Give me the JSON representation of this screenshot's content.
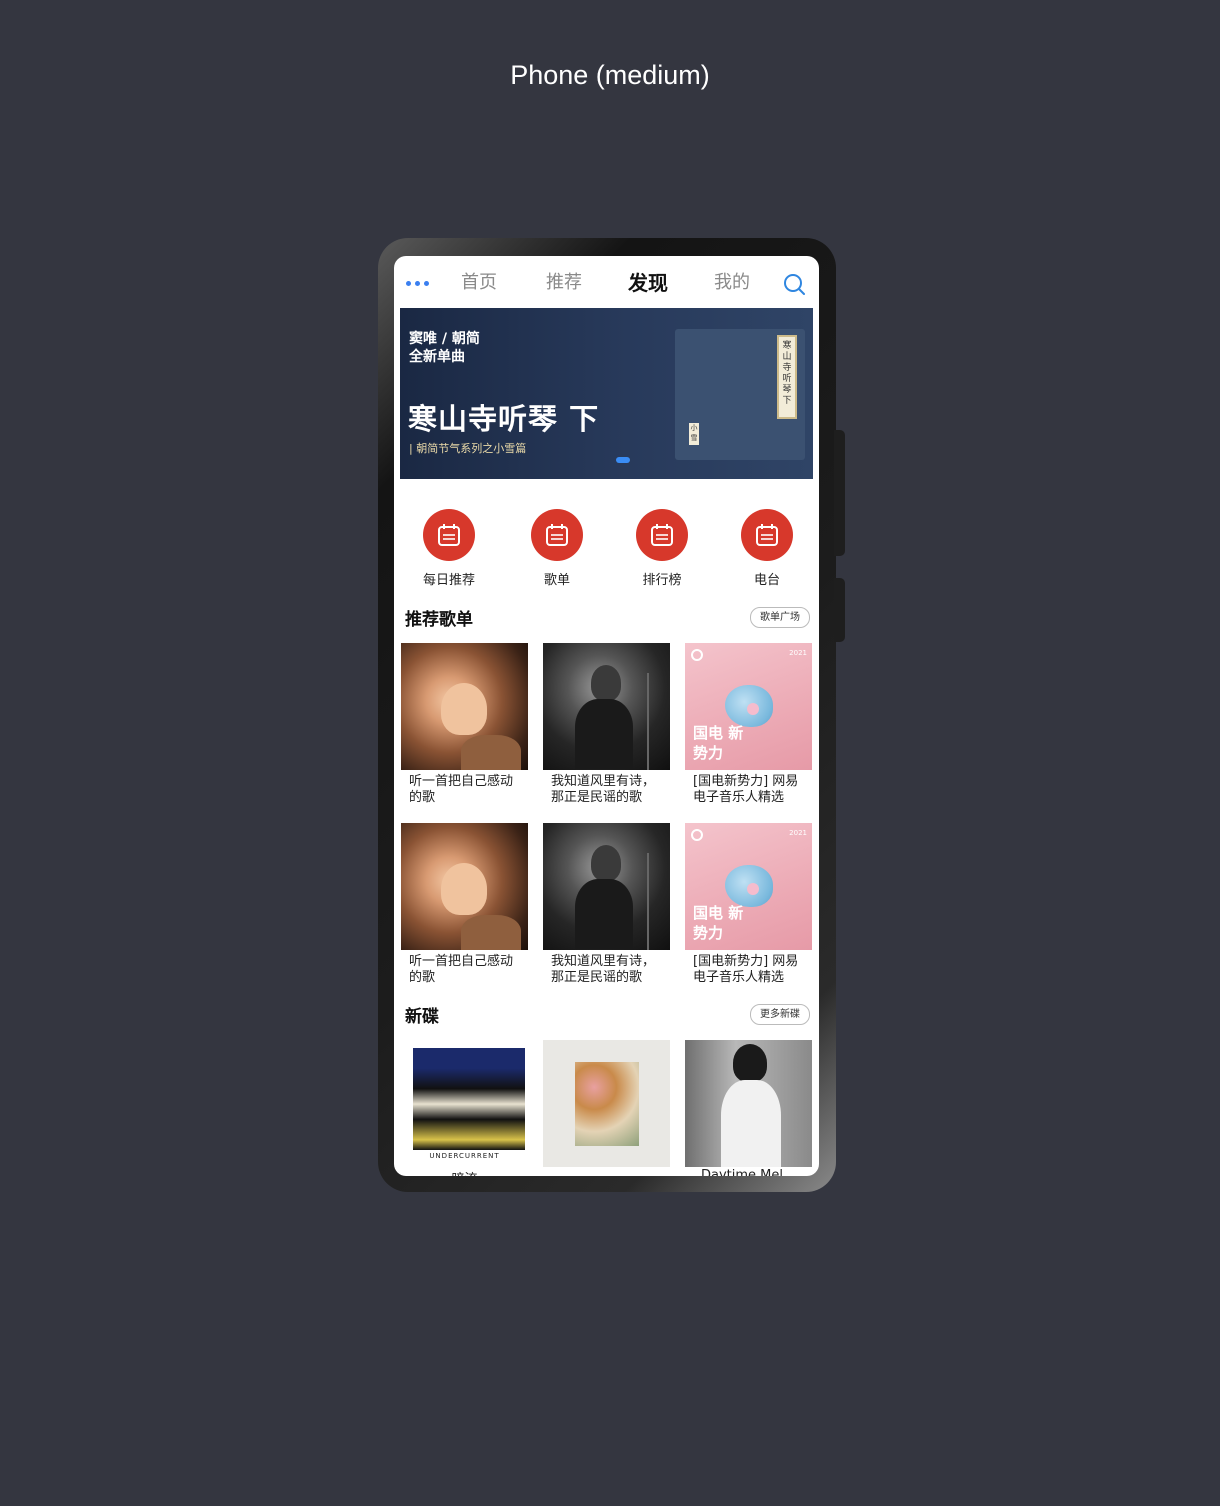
{
  "frame_title": "Phone (medium)",
  "nav": {
    "tabs": [
      "首页",
      "推荐",
      "发现",
      "我的"
    ],
    "active_tab": "发现"
  },
  "banner": {
    "artist_line1": "窦唯 / 朝简",
    "artist_line2": "全新单曲",
    "title": "寒山寺听琴 下",
    "subtitle": "| 朝简节气系列之小雪篇",
    "cover_tag": "寒山寺听琴下",
    "cover_small": "小雪"
  },
  "quick_links": [
    "每日推荐",
    "歌单",
    "排行榜",
    "电台"
  ],
  "recommended": {
    "title": "推荐歌单",
    "more_button": "歌单广场",
    "playlists": [
      {
        "name": "听一首把自己感动的歌",
        "cover": "warm-portrait"
      },
      {
        "name": "我知道风里有诗，那正是民谣的歌",
        "cover": "bw-singer"
      },
      {
        "name": "[国电新势力] 网易电子音乐人精选",
        "cover": "pink-drop",
        "cover_text": "国电 新势力",
        "cover_year": "2021"
      },
      {
        "name": "听一首把自己感动的歌",
        "cover": "warm-portrait"
      },
      {
        "name": "我知道风里有诗，那正是民谣的歌",
        "cover": "bw-singer"
      },
      {
        "name": "[国电新势力] 网易电子音乐人精选",
        "cover": "pink-drop",
        "cover_text": "国电 新势力",
        "cover_year": "2021"
      }
    ]
  },
  "new_albums": {
    "title": "新碟",
    "more_button": "更多新碟",
    "albums": [
      {
        "name": "暗流",
        "cover_text": "UNDERCURRENT"
      },
      {
        "name": "…",
        "cover_text": ""
      },
      {
        "name": "Daytime Mel…",
        "cover_text": ""
      }
    ]
  }
}
